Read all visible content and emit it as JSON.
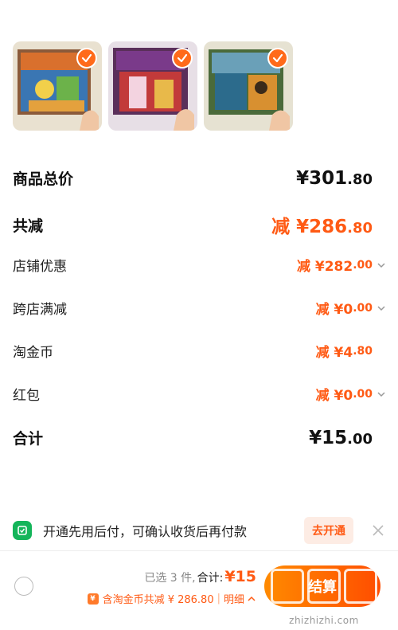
{
  "products": [
    {
      "name": "product-thumb-1",
      "palette": [
        "#d9c9a7",
        "#3a76b3",
        "#e4a13d"
      ]
    },
    {
      "name": "product-thumb-2",
      "palette": [
        "#cfc0d8",
        "#7a2a6a",
        "#c23a3a"
      ]
    },
    {
      "name": "product-thumb-3",
      "palette": [
        "#d7d2b8",
        "#2c6b8c",
        "#d89030"
      ]
    }
  ],
  "summary": {
    "goods_total": {
      "label": "商品总价",
      "int": "¥301",
      "dec": ".80"
    },
    "total_reduce": {
      "label": "共减",
      "int": "减 ¥286",
      "dec": ".80"
    },
    "shop_discount": {
      "label": "店铺优惠",
      "int": "减 ¥282",
      "dec": ".00"
    },
    "cross_shop": {
      "label": "跨店满减",
      "int": "减 ¥0",
      "dec": ".00"
    },
    "coins": {
      "label": "淘金币",
      "int": "减 ¥4",
      "dec": ".80"
    },
    "red_packet": {
      "label": "红包",
      "int": "减 ¥0",
      "dec": ".00"
    },
    "grand_total": {
      "label": "合计",
      "int": "¥15",
      "dec": ".00"
    }
  },
  "notice": {
    "text": "开通先用后付，可确认收货后再付款",
    "button": "去开通"
  },
  "footer": {
    "selected_text": "已选 3 件,",
    "total_label": "合计:",
    "total_value": "¥15",
    "coin_text": "含淘金币共减 ¥ 286.80",
    "detail": "明细",
    "submit": "结算"
  },
  "watermark": {
    "site": "zhizhizhi.com"
  },
  "colors": {
    "accent": "#ff5a14",
    "notice_icon": "#14b55a"
  }
}
